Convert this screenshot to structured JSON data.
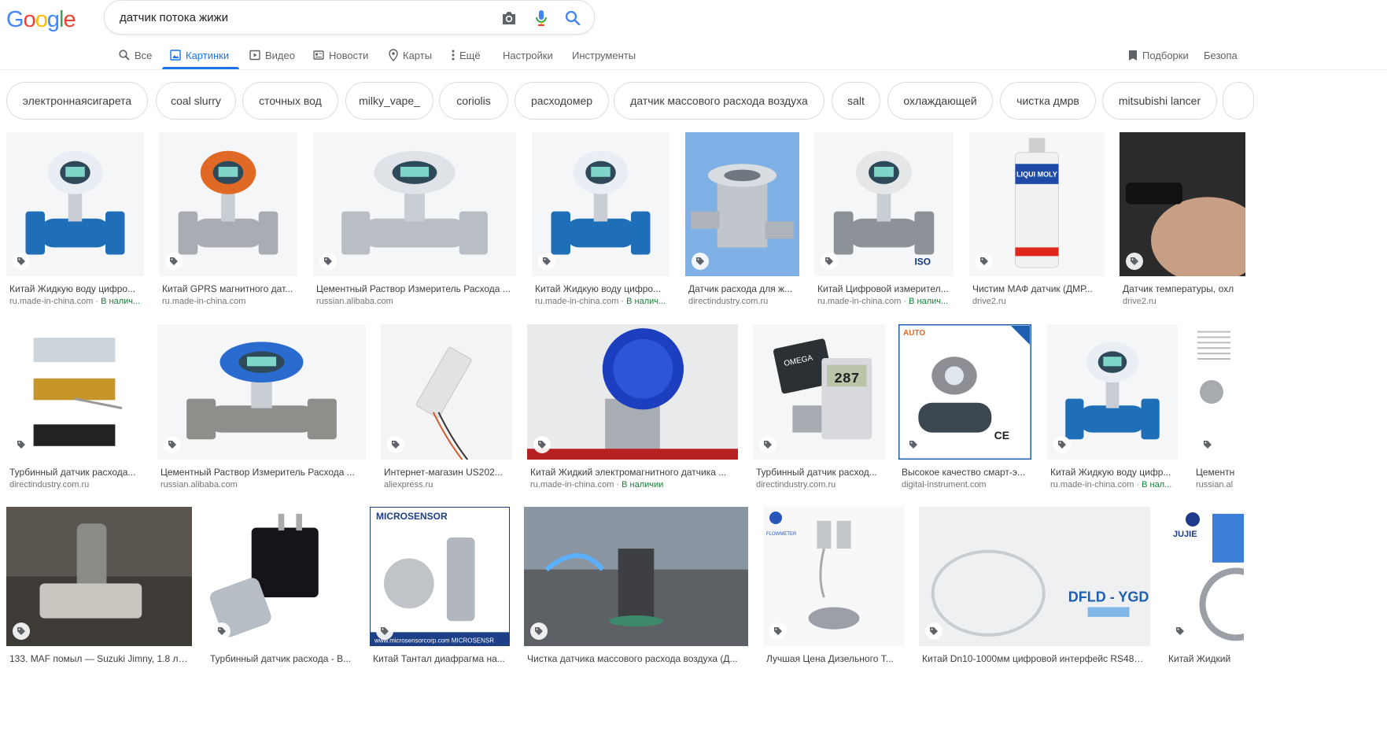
{
  "logo": {
    "letters": [
      "G",
      "o",
      "o",
      "g",
      "l",
      "e"
    ],
    "colors": [
      "#4285f4",
      "#ea4335",
      "#fbbc05",
      "#4285f4",
      "#34a853",
      "#ea4335"
    ]
  },
  "search": {
    "query": "датчик потока жижи"
  },
  "tabs": [
    {
      "label": "Все",
      "icon": "search-icon"
    },
    {
      "label": "Картинки",
      "icon": "image-icon",
      "active": true
    },
    {
      "label": "Видео",
      "icon": "video-icon"
    },
    {
      "label": "Новости",
      "icon": "news-icon"
    },
    {
      "label": "Карты",
      "icon": "map-pin-icon"
    },
    {
      "label": "Ещё",
      "icon": "more-vert-icon"
    },
    {
      "label": "Настройки"
    },
    {
      "label": "Инструменты"
    }
  ],
  "right_links": {
    "collections": "Подборки",
    "safe_search": "Безопа"
  },
  "chips": [
    "электроннаясигарета",
    "coal slurry",
    "сточных вод",
    "milky_vape_",
    "coriolis",
    "расходомер",
    "датчик массового расхода воздуха",
    "salt",
    "охлаждающей",
    "чистка дмрв",
    "mitsubishi lancer"
  ],
  "results": [
    {
      "caption": "Китай Жидкую воду цифро...",
      "source": "ru.made-in-china.com",
      "stock": "В налич...",
      "art": "blue"
    },
    {
      "caption": "Китай GPRS магнитного дат...",
      "source": "ru.made-in-china.com",
      "art": "orange"
    },
    {
      "caption": "Цементный Раствор Измеритель Расхода ...",
      "source": "russian.alibaba.com",
      "art": "steel"
    },
    {
      "caption": "Китай Жидкую воду цифро...",
      "source": "ru.made-in-china.com",
      "stock": "В налич...",
      "art": "blue"
    },
    {
      "caption": "Датчик расхода для ж...",
      "source": "directindustry.com.ru",
      "art": "flange"
    },
    {
      "caption": "Китай Цифровой измерител...",
      "source": "ru.made-in-china.com",
      "stock": "В налич...",
      "art": "gray"
    },
    {
      "caption": "Чистим МАФ датчик (ДМР...",
      "source": "drive2.ru",
      "art": "spray"
    },
    {
      "caption": "Датчик температуры, охл",
      "source": "drive2.ru",
      "art": "hand"
    },
    {
      "caption": "Турбинный датчик расхода...",
      "source": "directindustry.com.ru",
      "art": "brass"
    },
    {
      "caption": "Цементный Раствор Измеритель Расхода ...",
      "source": "russian.alibaba.com",
      "art": "bigblue"
    },
    {
      "caption": "Интернет-магазин US202...",
      "source": "aliexpress.ru",
      "art": "chip"
    },
    {
      "caption": "Китай Жидкий электромагнитного датчика ...",
      "source": "ru.made-in-china.com",
      "stock": "В наличии",
      "art": "bluecap"
    },
    {
      "caption": "Турбинный датчик расход...",
      "source": "directindustry.com.ru",
      "art": "omega"
    },
    {
      "caption": "Высокое качество смарт-э...",
      "source": "digital-instrument.com",
      "art": "auto"
    },
    {
      "caption": "Китай Жидкую воду цифр...",
      "source": "ru.made-in-china.com",
      "stock": "В нал...",
      "art": "blue"
    },
    {
      "caption": "Цементн",
      "source": "russian.al",
      "art": "doc"
    },
    {
      "caption": "133. MAF помыл — Suzuki Jimny, 1.8 л.,...",
      "source": "",
      "art": "maf"
    },
    {
      "caption": "Турбинный датчик расхода - В...",
      "source": "",
      "art": "black"
    },
    {
      "caption": "Китай Тантал диафрагма на...",
      "source": "",
      "art": "micro"
    },
    {
      "caption": "Чистка датчика массового расхода воздуха (Д...",
      "source": "",
      "art": "engine"
    },
    {
      "caption": "Лучшая Цена Дизельного Т...",
      "source": "",
      "art": "orifice"
    },
    {
      "caption": "Китай Dn10-1000мм цифровой интерфейс RS485...",
      "source": "",
      "art": "dfld"
    },
    {
      "caption": "Китай Жидкий",
      "source": "",
      "art": "jujie"
    }
  ],
  "overlay_texts": {
    "iso": "ISO",
    "liqui": "LIQUI MOLY",
    "omega": "OMEGA",
    "reading": "287",
    "auto": "AUTO",
    "ce": "CE",
    "microsensor": "MICROSENSOR",
    "microsensor_url": "www.microsensorcorp.com  MICROSENSR",
    "dfld": "DFLD - YGD",
    "jujie": "JUJIE",
    "flowmeter": "FLOWMETER"
  }
}
